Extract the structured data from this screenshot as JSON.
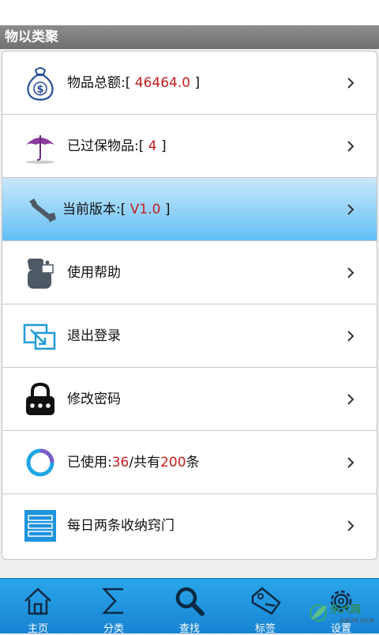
{
  "header": {
    "title": "物以类聚"
  },
  "items": [
    {
      "label": "物品总额:[ ",
      "value": "46464.0",
      "suffix": " ]",
      "icon": "money-bag-icon"
    },
    {
      "label": "已过保物品:[ ",
      "value": "4",
      "suffix": " ]",
      "icon": "umbrella-icon"
    },
    {
      "label": "当前版本:[ ",
      "value": "V1.0",
      "suffix": " ]",
      "icon": "wrench-icon",
      "selected": true
    },
    {
      "label": "使用帮助",
      "icon": "help-lighter-icon"
    },
    {
      "label": "退出登录",
      "icon": "logout-icon"
    },
    {
      "label": "修改密码",
      "icon": "lock-icon"
    },
    {
      "label_a": "已使用:",
      "used": "36",
      "label_b": "/共有",
      "total": "200",
      "label_c": "条",
      "icon": "ring-icon"
    },
    {
      "label": "每日两条收纳窍门",
      "icon": "list-icon"
    }
  ],
  "tabs": [
    {
      "label": "主页",
      "icon": "home-icon"
    },
    {
      "label": "分类",
      "icon": "sigma-icon"
    },
    {
      "label": "查找",
      "icon": "search-icon"
    },
    {
      "label": "标签",
      "icon": "tag-icon"
    },
    {
      "label": "设置",
      "icon": "gear-icon"
    }
  ],
  "watermark": {
    "text": "乐六网",
    "sub": "乐享好用 无负担"
  },
  "colors": {
    "tabbar": "#1e93de",
    "highlight": "#c41e1e",
    "selected_row": "#63bff6"
  }
}
